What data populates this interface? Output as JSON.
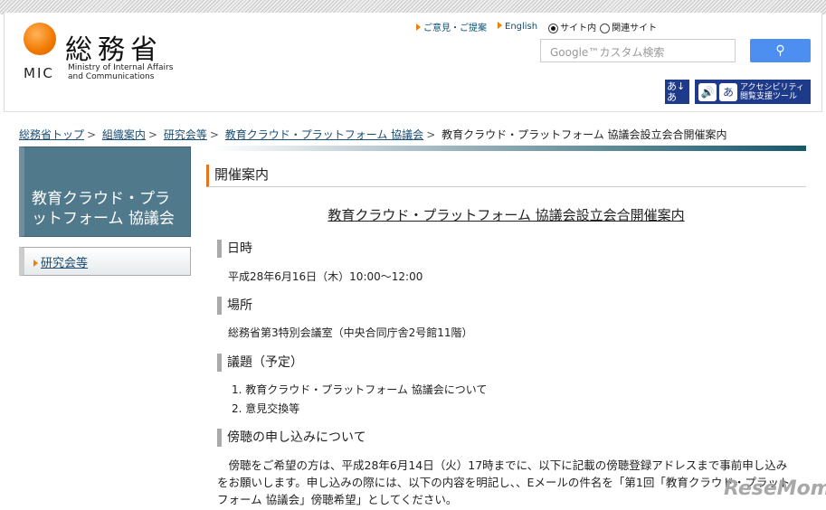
{
  "header": {
    "logo_jp": "総務省",
    "logo_abbr": "MIC",
    "logo_en_1": "Ministry of Internal Affairs",
    "logo_en_2": "and Communications",
    "links": [
      "ご意見・ご提案",
      "English"
    ],
    "radio_site": "サイト内",
    "radio_related": "関連サイト",
    "search_placeholder": "Google™カスタム検索",
    "accessibility_font": "あ↓あ",
    "accessibility_tool_1": "アクセシビリティ",
    "accessibility_tool_2": "閲覧支援ツール"
  },
  "breadcrumb": [
    "総務省トップ",
    "組織案内",
    "研究会等",
    "教育クラウド・プラットフォーム 協議会",
    "教育クラウド・プラットフォーム 協議会設立会合開催案内"
  ],
  "sidebar": {
    "title": "教育クラウド・プラットフォーム 協議会",
    "item": "研究会等"
  },
  "main": {
    "heading": "開催案内",
    "title": "教育クラウド・プラットフォーム 協議会設立会合開催案内",
    "sections": [
      {
        "heading": "日時",
        "text": "平成28年6月16日（木）10:00～12:00"
      },
      {
        "heading": "場所",
        "text": "総務省第3特別会議室（中央合同庁舎2号館11階）"
      },
      {
        "heading": "議題（予定）",
        "items": [
          "1. 教育クラウド・プラットフォーム 協議会について",
          "2. 意見交換等"
        ]
      },
      {
        "heading": "傍聴の申し込みについて",
        "text": "傍聴をご希望の方は、平成28年6月14日（火）17時までに、以下に記載の傍聴登録アドレスまで事前申し込みをお願いします。申し込みの際には、以下の内容を明記し、、Eメールの件名を「第1回「教育クラウド・プラットフォーム 協議会」傍聴希望」としてください。"
      }
    ]
  },
  "watermark": "ReseMom"
}
